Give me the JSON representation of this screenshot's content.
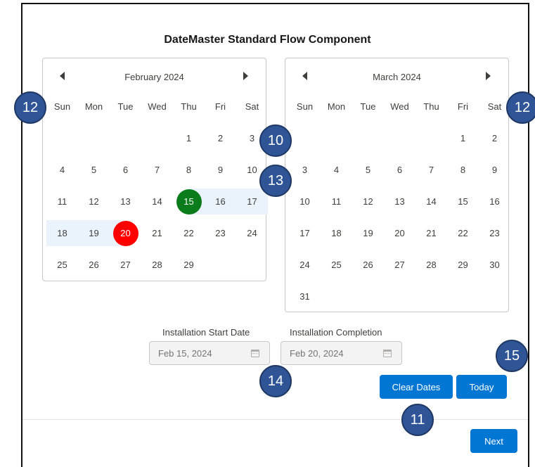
{
  "title": "DateMaster Standard Flow Component",
  "calendars": [
    {
      "month": "February 2024",
      "weekdays": [
        "Sun",
        "Mon",
        "Tue",
        "Wed",
        "Thu",
        "Fri",
        "Sat"
      ],
      "weeks": [
        [
          "",
          "",
          "",
          "",
          "1",
          "2",
          "3"
        ],
        [
          "4",
          "5",
          "6",
          "7",
          "8",
          "9",
          "10"
        ],
        [
          "11",
          "12",
          "13",
          "14",
          "15",
          "16",
          "17"
        ],
        [
          "18",
          "19",
          "20",
          "21",
          "22",
          "23",
          "24"
        ],
        [
          "25",
          "26",
          "27",
          "28",
          "29",
          "",
          ""
        ]
      ],
      "range_start": "15",
      "range_end": "20"
    },
    {
      "month": "March 2024",
      "weekdays": [
        "Sun",
        "Mon",
        "Tue",
        "Wed",
        "Thu",
        "Fri",
        "Sat"
      ],
      "weeks": [
        [
          "",
          "",
          "",
          "",
          "",
          "1",
          "2"
        ],
        [
          "3",
          "4",
          "5",
          "6",
          "7",
          "8",
          "9"
        ],
        [
          "10",
          "11",
          "12",
          "13",
          "14",
          "15",
          "16"
        ],
        [
          "17",
          "18",
          "19",
          "20",
          "21",
          "22",
          "23"
        ],
        [
          "24",
          "25",
          "26",
          "27",
          "28",
          "29",
          "30"
        ],
        [
          "31",
          "",
          "",
          "",
          "",
          "",
          ""
        ]
      ]
    }
  ],
  "fields": {
    "start": {
      "label": "Installation Start Date",
      "value": "Feb 15, 2024"
    },
    "end": {
      "label": "Installation Completion",
      "value": "Feb 20, 2024"
    }
  },
  "buttons": {
    "clear": "Clear Dates",
    "today": "Today",
    "next": "Next"
  },
  "badges": {
    "b10": "10",
    "b11": "11",
    "b12_left": "12",
    "b12_right": "12",
    "b13": "13",
    "b14": "14",
    "b15": "15"
  },
  "colors": {
    "range_start": "#0b7c1b",
    "range_end": "#ff0000",
    "range_fill": "#eaf3fc",
    "brand_button": "#0176d3",
    "badge": "#2f5597"
  }
}
